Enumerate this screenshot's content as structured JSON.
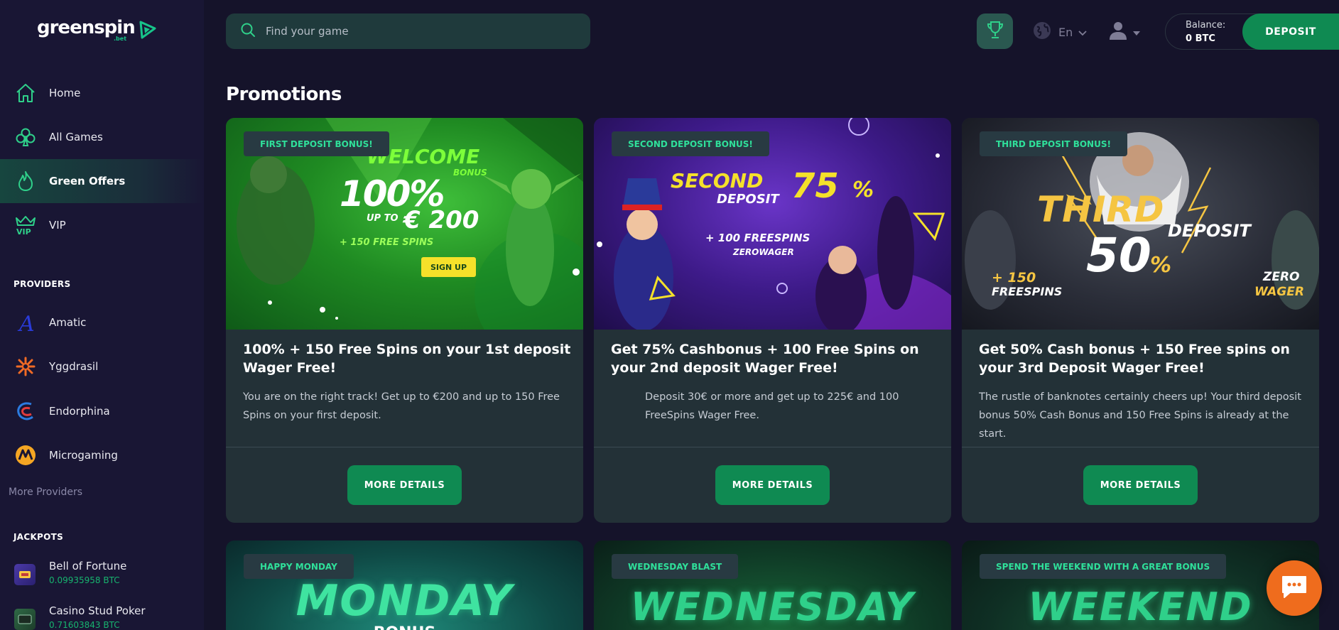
{
  "logo": {
    "name": "greenspin",
    "suffix": ".bet"
  },
  "sidebar": {
    "nav": [
      {
        "label": "Home",
        "icon": "home-icon"
      },
      {
        "label": "All Games",
        "icon": "clubs-icon"
      },
      {
        "label": "Green Offers",
        "icon": "flame-icon",
        "active": true
      },
      {
        "label": "VIP",
        "icon": "crown-icon"
      }
    ],
    "providers_title": "PROVIDERS",
    "providers": [
      {
        "label": "Amatic",
        "icon": "amatic-icon"
      },
      {
        "label": "Yggdrasil",
        "icon": "yggdrasil-icon"
      },
      {
        "label": "Endorphina",
        "icon": "endorphina-icon"
      },
      {
        "label": "Microgaming",
        "icon": "microgaming-icon"
      }
    ],
    "more_providers": "More Providers",
    "jackpots_title": "JACKPOTS",
    "jackpots": [
      {
        "name": "Bell of Fortune",
        "value": "0.09935958 BTC"
      },
      {
        "name": "Casino Stud Poker",
        "value": "0.71603843 BTC"
      }
    ]
  },
  "header": {
    "search_placeholder": "Find your game",
    "language": "En",
    "balance_label": "Balance:",
    "balance_value": "0 BTC",
    "deposit_label": "DEPOSIT"
  },
  "page": {
    "title": "Promotions"
  },
  "promotions": [
    {
      "tag": "FIRST DEPOSIT BONUS!",
      "title": "100% + 150 Free Spins on your 1st deposit Wager Free!",
      "description": "You are on the right track! Get up to €200 and up to 150 Free Spins on your first deposit.",
      "button": "MORE DETAILS",
      "banner": {
        "line1": "WELCOME",
        "line1b": "BONUS",
        "line2": "100%",
        "line3": "UP TO",
        "line3b": "€ 200",
        "line4": "+ 150 FREE SPINS",
        "cta": "SIGN UP"
      }
    },
    {
      "tag": "SECOND DEPOSIT BONUS!",
      "title": "Get 75% Cashbonus + 100 Free Spins on your 2nd deposit Wager Free!",
      "description": "Deposit 30€ or more and get up to 225€ and 100 FreeSpins Wager Free.",
      "button": "MORE DETAILS",
      "banner": {
        "line1": "SECOND",
        "line2": "DEPOSIT",
        "line3": "75",
        "line3b": "%",
        "line4": "+ 100 FREESPINS",
        "line5": "ZEROWAGER"
      }
    },
    {
      "tag": "THIRD DEPOSIT BONUS!",
      "title": "Get 50% Cash bonus + 150 Free spins on your 3rd Deposit Wager Free!",
      "description": "The rustle of banknotes certainly cheers up! Your third deposit bonus 50% Cash Bonus and 150 Free Spins is already at the start.",
      "button": "MORE DETAILS",
      "banner": {
        "line1": "THIRD",
        "line2": "DEPOSIT",
        "line3": "50",
        "line3b": "%",
        "line4": "+ 150",
        "line4b": "FREESPINS",
        "line5": "ZERO",
        "line5b": "WAGER"
      }
    }
  ],
  "promotions_row2": [
    {
      "tag": "HAPPY MONDAY",
      "banner": "MONDAY",
      "banner_sub": "BONUS"
    },
    {
      "tag": "WEDNESDAY BLAST",
      "banner": "WEDNESDAY"
    },
    {
      "tag": "SPEND THE WEEKEND WITH A GREAT BONUS",
      "banner": "WEEKEND"
    }
  ],
  "colors": {
    "accent": "#0f8a52",
    "tag_text": "#2fe09a",
    "sidebar": "#191634",
    "bg": "#15132a",
    "card": "#233137",
    "chat": "#ef6c1d"
  }
}
